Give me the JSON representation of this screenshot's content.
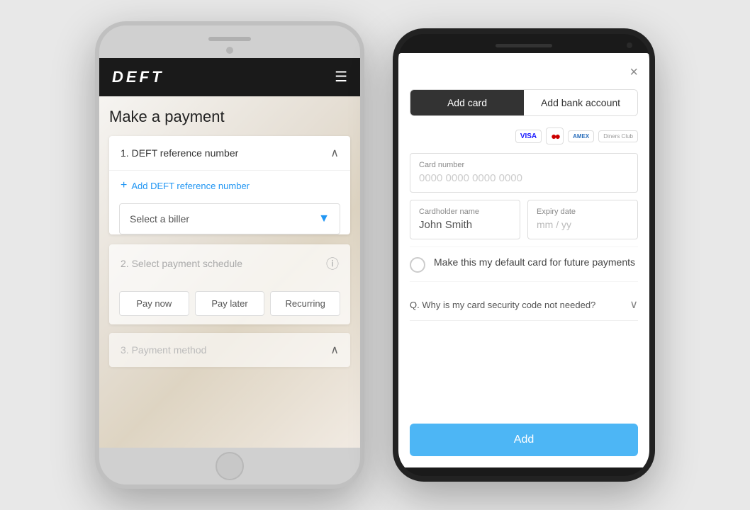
{
  "left_phone": {
    "logo": "DEFT",
    "page_title": "Make a payment",
    "section1": {
      "number": "1.",
      "label": "DEFT reference number",
      "add_ref_label": "Add DEFT reference number",
      "biller_placeholder": "Select a biller"
    },
    "section2": {
      "number": "2.",
      "label": "Select payment schedule",
      "pay_now": "Pay now",
      "pay_later": "Pay later",
      "recurring": "Recurring"
    },
    "section3": {
      "number": "3.",
      "label": "Payment method"
    }
  },
  "right_phone": {
    "close_label": "×",
    "tab_add_card": "Add card",
    "tab_add_bank": "Add bank account",
    "card_logos": [
      "VISA",
      "MC",
      "AMEX",
      "Diners"
    ],
    "card_number_label": "Card number",
    "card_number_placeholder": "0000 0000 0000 0000",
    "cardholder_label": "Cardholder name",
    "cardholder_placeholder": "John Smith",
    "expiry_label": "Expiry date",
    "expiry_placeholder": "mm / yy",
    "default_card_text": "Make this my default card for future payments",
    "faq_text": "Q. Why is my card security code not needed?",
    "add_button_label": "Add"
  }
}
